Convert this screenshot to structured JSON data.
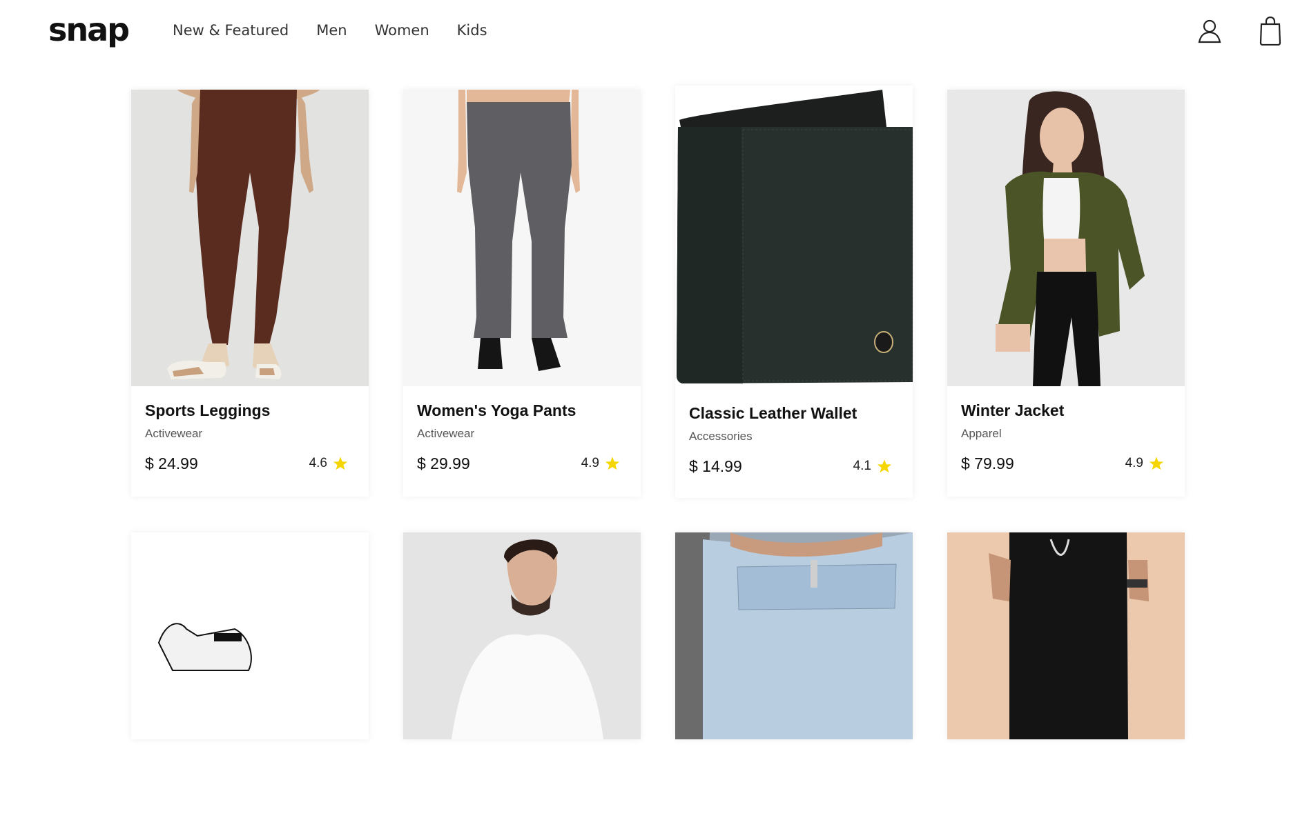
{
  "header": {
    "logo": "snap",
    "nav": [
      "New & Featured",
      "Men",
      "Women",
      "Kids"
    ],
    "icons": [
      "user-icon",
      "shopping-bag-icon"
    ]
  },
  "products": [
    {
      "name": "Sports Leggings",
      "category": "Activewear",
      "price": "$ 24.99",
      "rating": "4.6",
      "image": "brown-leggings"
    },
    {
      "name": "Women's Yoga Pants",
      "category": "Activewear",
      "price": "$ 29.99",
      "rating": "4.9",
      "image": "grey-yoga-pants"
    },
    {
      "name": "Classic Leather Wallet",
      "category": "Accessories",
      "price": "$ 14.99",
      "rating": "4.1",
      "image": "black-wallet"
    },
    {
      "name": "Winter Jacket",
      "category": "Apparel",
      "price": "$ 79.99",
      "rating": "4.9",
      "image": "green-jacket"
    }
  ],
  "row2_images": [
    "white-sneaker",
    "man-white-shirt",
    "blue-jeans",
    "black-joggers"
  ],
  "colors": {
    "star": "#f6d600",
    "text": "#111111",
    "muted": "#555555"
  }
}
